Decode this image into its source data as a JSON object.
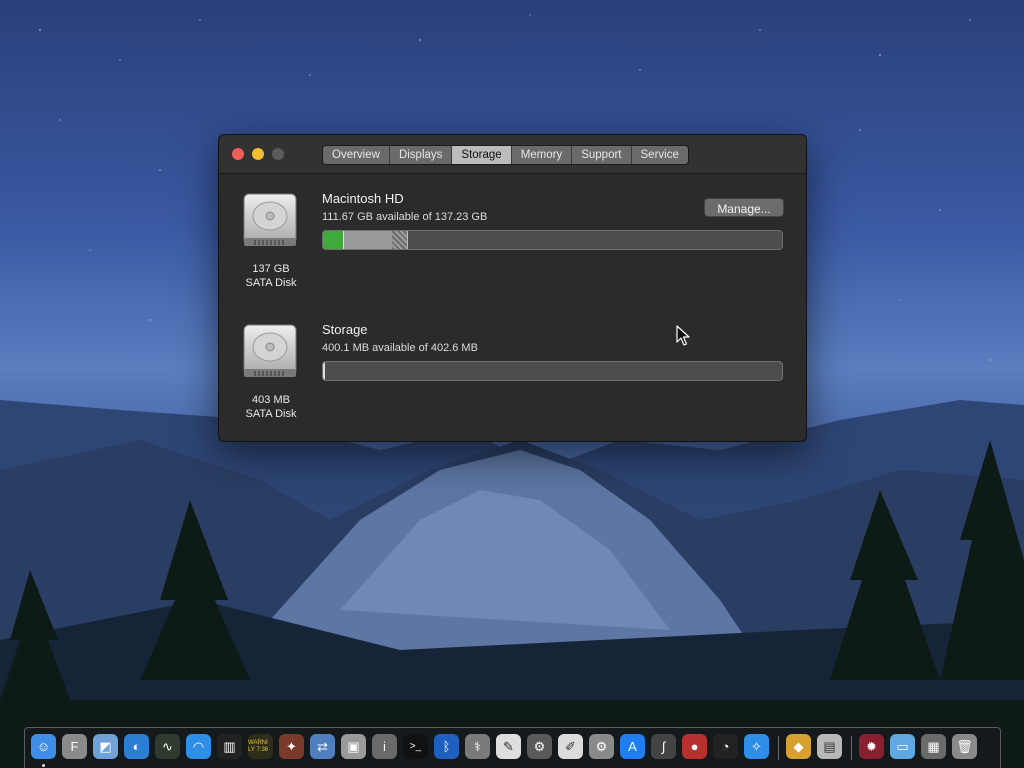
{
  "window": {
    "tabs": [
      "Overview",
      "Displays",
      "Storage",
      "Memory",
      "Support",
      "Service"
    ],
    "active_tab": "Storage"
  },
  "disks": [
    {
      "name": "Macintosh HD",
      "available": "111.67 GB available of 137.23 GB",
      "capacity": "137 GB",
      "type": "SATA Disk",
      "manage_label": "Manage...",
      "used_fraction": 0.186,
      "colors": {
        "apps": "#3faa3c",
        "other": "#9a9a9a"
      }
    },
    {
      "name": "Storage",
      "available": "400.1 MB available of 402.6 MB",
      "capacity": "403 MB",
      "type": "SATA Disk",
      "used_fraction": 0.006
    }
  ],
  "dock": {
    "items": [
      {
        "name": "finder-icon",
        "color": "#3f8fe8"
      },
      {
        "name": "font-book-icon",
        "color": "#8a8a8a"
      },
      {
        "name": "preview-icon",
        "color": "#6fa2d6"
      },
      {
        "name": "edge-browser-icon",
        "color": "#2a7fd4"
      },
      {
        "name": "activity-monitor-icon",
        "color": "#2e3b2e"
      },
      {
        "name": "wifi-icon",
        "color": "#2e8fe8"
      },
      {
        "name": "piano-icon",
        "color": "#222"
      },
      {
        "name": "console-icon",
        "color": "#2d2d1a"
      },
      {
        "name": "compass-icon",
        "color": "#7a3a2a"
      },
      {
        "name": "migration-assistant-icon",
        "color": "#4f7fbf"
      },
      {
        "name": "screenshot-icon",
        "color": "#9a9a9a"
      },
      {
        "name": "system-information-icon",
        "color": "#6a6a6a"
      },
      {
        "name": "terminal-icon",
        "color": "#111"
      },
      {
        "name": "bluetooth-icon",
        "color": "#1f5fbf"
      },
      {
        "name": "disk-utility-icon",
        "color": "#7a7a7a"
      },
      {
        "name": "textedit-icon",
        "color": "#dedede"
      },
      {
        "name": "automator-icon",
        "color": "#5a5a5a"
      },
      {
        "name": "script-editor-icon",
        "color": "#dcdcdc"
      },
      {
        "name": "system-preferences-icon",
        "color": "#8a8a8a"
      },
      {
        "name": "app-store-icon",
        "color": "#1f7ff0"
      },
      {
        "name": "grapher-icon",
        "color": "#444"
      },
      {
        "name": "photo-booth-icon",
        "color": "#b72f2f"
      },
      {
        "name": "dashboard-icon",
        "color": "#222"
      },
      {
        "name": "safari-icon",
        "color": "#2f8fe8"
      },
      {
        "name": "color-picker-icon",
        "color": "#d8a030"
      },
      {
        "name": "archive-utility-icon",
        "color": "#b8b8b8"
      },
      {
        "name": "photo-app-icon",
        "color": "#8a1f2f"
      },
      {
        "name": "downloads-folder-icon",
        "color": "#5fa8e0"
      },
      {
        "name": "documents-stack-icon",
        "color": "#6a6a6a"
      },
      {
        "name": "trash-icon",
        "color": "#8a8a8a"
      }
    ],
    "glyphs": {
      "font_book": "F",
      "console": "WARNI LY 7:36",
      "terminal": ">_"
    }
  }
}
